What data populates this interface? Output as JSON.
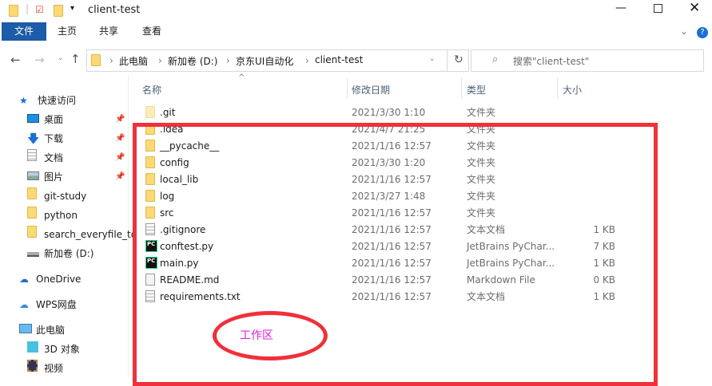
{
  "window": {
    "title": "client-test",
    "minimize_icon": "minimize",
    "maximize_icon": "maximize",
    "close_icon": "close"
  },
  "ribbon": {
    "tabs": [
      "文件",
      "主页",
      "共享",
      "查看"
    ]
  },
  "address": {
    "crumbs": [
      "此电脑",
      "新加卷 (D:)",
      "京东UI自动化",
      "client-test"
    ]
  },
  "search": {
    "placeholder": "搜索\"client-test\""
  },
  "columns": {
    "name": "名称",
    "date": "修改日期",
    "type": "类型",
    "size": "大小"
  },
  "sidebar": [
    {
      "label": "快速访问",
      "icon": "star"
    },
    {
      "label": "桌面",
      "icon": "desktop",
      "pinned": true
    },
    {
      "label": "下载",
      "icon": "download",
      "pinned": true
    },
    {
      "label": "文档",
      "icon": "document",
      "pinned": true
    },
    {
      "label": "图片",
      "icon": "pictures",
      "pinned": true
    },
    {
      "label": "git-study",
      "icon": "folder"
    },
    {
      "label": "python",
      "icon": "folder"
    },
    {
      "label": "search_everyfile_to",
      "icon": "folder"
    },
    {
      "label": "新加卷 (D:)",
      "icon": "drive"
    },
    {
      "label": "OneDrive",
      "icon": "cloud"
    },
    {
      "label": "WPS网盘",
      "icon": "cloud-outline"
    },
    {
      "label": "此电脑",
      "icon": "computer"
    },
    {
      "label": "3D 对象",
      "icon": "cube"
    },
    {
      "label": "视频",
      "icon": "video"
    }
  ],
  "files": [
    {
      "name": ".git",
      "date": "2021/3/30 1:10",
      "type": "文件夹",
      "size": "",
      "icon": "folder"
    },
    {
      "name": ".idea",
      "date": "2021/4/7 21:25",
      "type": "文件夹",
      "size": "",
      "icon": "folder"
    },
    {
      "name": "__pycache__",
      "date": "2021/1/16 12:57",
      "type": "文件夹",
      "size": "",
      "icon": "folder"
    },
    {
      "name": "config",
      "date": "2021/3/30 1:20",
      "type": "文件夹",
      "size": "",
      "icon": "folder"
    },
    {
      "name": "local_lib",
      "date": "2021/1/16 12:57",
      "type": "文件夹",
      "size": "",
      "icon": "folder"
    },
    {
      "name": "log",
      "date": "2021/3/27 1:48",
      "type": "文件夹",
      "size": "",
      "icon": "folder"
    },
    {
      "name": "src",
      "date": "2021/1/16 12:57",
      "type": "文件夹",
      "size": "",
      "icon": "folder"
    },
    {
      "name": ".gitignore",
      "date": "2021/1/16 12:57",
      "type": "文本文档",
      "size": "1 KB",
      "icon": "text"
    },
    {
      "name": "conftest.py",
      "date": "2021/1/16 12:57",
      "type": "JetBrains PyChar...",
      "size": "7 KB",
      "icon": "pycharm"
    },
    {
      "name": "main.py",
      "date": "2021/1/16 12:57",
      "type": "JetBrains PyChar...",
      "size": "1 KB",
      "icon": "pycharm"
    },
    {
      "name": "README.md",
      "date": "2021/1/16 12:57",
      "type": "Markdown File",
      "size": "0 KB",
      "icon": "markdown"
    },
    {
      "name": "requirements.txt",
      "date": "2021/1/16 12:57",
      "type": "文本文档",
      "size": "1 KB",
      "icon": "text"
    }
  ],
  "annotation": {
    "label": "工作区",
    "color": "#f0303a",
    "label_color": "#e020e0"
  }
}
